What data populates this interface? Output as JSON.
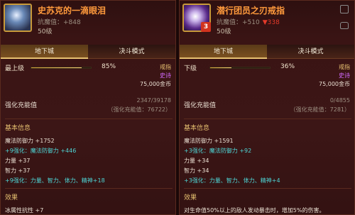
{
  "left": {
    "icon": "staff-crystal-icon",
    "badge": "",
    "name": "史苏克的一滴眼泪",
    "sub": "抗魔值：+848",
    "sub_red": "",
    "level": "50级",
    "tabs": [
      "地下城",
      "决斗模式"
    ],
    "rank_label": "最上级",
    "rank_pct": "85%",
    "rank_fill": 0.85,
    "type": "戒指",
    "rarity": "史诗",
    "price": "75,000金币",
    "enhance_label": "强化充能值",
    "enhance_value": "2347/39178",
    "enhance_cap": "（强化充能值：76722）",
    "basic_title": "基本信息",
    "stats": [
      {
        "text": "魔法防御力 +1752",
        "color": "white"
      },
      {
        "text": "+9强化：魔法防御力 +446",
        "color": "cyan"
      },
      {
        "text": "力量 +37",
        "color": "white"
      },
      {
        "text": "智力 +37",
        "color": "white"
      },
      {
        "text": "+9强化：力量、智力、体力、精神+18",
        "color": "cyan"
      }
    ],
    "effect_title": "效果",
    "effect_text": "冰属性抗性 +7"
  },
  "right": {
    "icon": "purple-ring-icon",
    "badge": "3",
    "name": "潜行团员之刃戒指",
    "sub": "抗魔值：+510",
    "sub_red": "▼338",
    "level": "50级",
    "tabs": [
      "地下城",
      "决斗模式"
    ],
    "rank_label": "下级",
    "rank_pct": "36%",
    "rank_fill": 0.36,
    "type": "戒指",
    "rarity": "史诗",
    "price": "75,000金币",
    "enhance_label": "强化充能值",
    "enhance_value": "0/4855",
    "enhance_cap": "（强化充能值：7281）",
    "basic_title": "基本信息",
    "stats": [
      {
        "text": "魔法防御力 +1591",
        "color": "white"
      },
      {
        "text": "+3强化：魔法防御力 +92",
        "color": "cyan"
      },
      {
        "text": "力量 +34",
        "color": "white"
      },
      {
        "text": "智力 +34",
        "color": "white"
      },
      {
        "text": "+3强化：力量、智力、体力、精神+4",
        "color": "cyan"
      }
    ],
    "effect_title": "效果",
    "effect_text": "对生命值50%以上的敌人发动暴击时，增加5%的伤害。"
  }
}
